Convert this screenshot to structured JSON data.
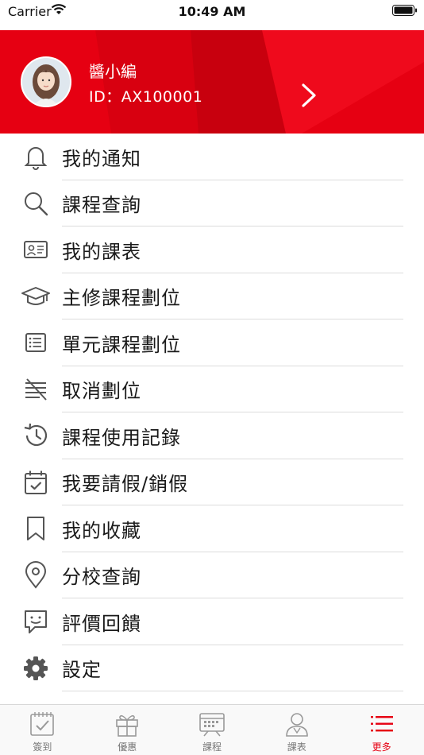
{
  "status_bar": {
    "carrier": "Carrier",
    "time": "10:49 AM"
  },
  "profile": {
    "name": "醬小編",
    "id_text": "ID：AX100001"
  },
  "colors": {
    "accent": "#e60012",
    "icon_gray": "#555555",
    "divider": "#dcdcdc"
  },
  "menu": [
    {
      "label": "我的通知",
      "icon": "bell-icon"
    },
    {
      "label": "課程查詢",
      "icon": "search-icon"
    },
    {
      "label": "我的課表",
      "icon": "id-card-icon"
    },
    {
      "label": "主修課程劃位",
      "icon": "graduation-cap-icon"
    },
    {
      "label": "單元課程劃位",
      "icon": "list-icon"
    },
    {
      "label": "取消劃位",
      "icon": "cancel-list-icon"
    },
    {
      "label": "課程使用記錄",
      "icon": "history-icon"
    },
    {
      "label": "我要請假/銷假",
      "icon": "calendar-check-icon"
    },
    {
      "label": "我的收藏",
      "icon": "bookmark-icon"
    },
    {
      "label": "分校查詢",
      "icon": "location-pin-icon"
    },
    {
      "label": "評價回饋",
      "icon": "feedback-icon"
    },
    {
      "label": "設定",
      "icon": "gear-icon"
    }
  ],
  "tabs": [
    {
      "label": "簽到",
      "icon": "checkin-icon",
      "active": false
    },
    {
      "label": "優惠",
      "icon": "gift-icon",
      "active": false
    },
    {
      "label": "課程",
      "icon": "course-icon",
      "active": false
    },
    {
      "label": "課表",
      "icon": "profile-icon",
      "active": false
    },
    {
      "label": "更多",
      "icon": "more-menu-icon",
      "active": true
    }
  ]
}
